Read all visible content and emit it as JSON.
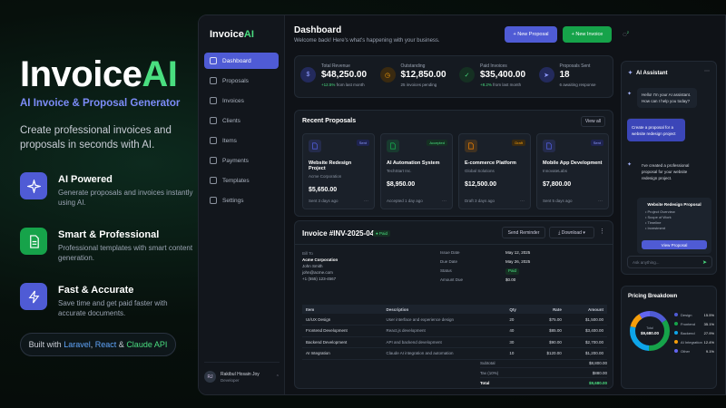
{
  "hero": {
    "brand_main": "Invoice",
    "brand_ai": "AI",
    "tagline": "AI Invoice & Proposal Generator",
    "subtitle": "Create professional invoices and proposals in seconds with AI.",
    "features": [
      {
        "title": "AI Powered",
        "desc": "Generate proposals and invoices instantly using AI.",
        "color": "#4f5bd5"
      },
      {
        "title": "Smart & Professional",
        "desc": "Professional templates with smart content generation.",
        "color": "#16a34a"
      },
      {
        "title": "Fast & Accurate",
        "desc": "Save time and get paid faster with accurate documents.",
        "color": "#4f5bd5"
      }
    ],
    "built_prefix": "Built with ",
    "built_l": "Laravel",
    "built_sep1": ", ",
    "built_r": "React",
    "built_sep2": " & ",
    "built_c": "Claude API"
  },
  "sidebar": {
    "logo_main": "Invoice",
    "logo_ai": "AI",
    "items": [
      {
        "label": "Dashboard"
      },
      {
        "label": "Proposals"
      },
      {
        "label": "Invoices"
      },
      {
        "label": "Clients"
      },
      {
        "label": "Items"
      },
      {
        "label": "Payments"
      },
      {
        "label": "Templates"
      },
      {
        "label": "Settings"
      }
    ],
    "user_initials": "RJ",
    "user_name": "Rakibul Hosain Joy",
    "user_role": "Developer"
  },
  "header": {
    "title": "Dashboard",
    "welcome": "Welcome back! Here's what's happening with your business.",
    "new_proposal": "+ New Proposal",
    "new_invoice": "+ New Invoice",
    "notif_count": "2"
  },
  "stats": [
    {
      "label": "Total Revenue",
      "value": "$48,250.00",
      "change": "+12.5%",
      "note": " from last month",
      "color": "#4f5bd5",
      "icon": "$"
    },
    {
      "label": "Outstanding",
      "value": "$12,850.00",
      "change": "",
      "note": "25 invoices pending",
      "color": "#d97706",
      "icon": "◷"
    },
    {
      "label": "Paid Invoices",
      "value": "$35,400.00",
      "change": "+8.2%",
      "note": " from last month",
      "color": "#16a34a",
      "icon": "✓"
    },
    {
      "label": "Proposals Sent",
      "value": "18",
      "change": "",
      "note": "6 awaiting response",
      "color": "#4f5bd5",
      "icon": "➤"
    }
  ],
  "proposals": {
    "title": "Recent Proposals",
    "view_all": "View all",
    "items": [
      {
        "title": "Website Redesign Project",
        "client": "Acme Corporation",
        "amount": "$5,650.00",
        "date": "Sent 3 days ago",
        "status": "Sent",
        "color": "#4f5bd5",
        "badge_bg": "#1e2350",
        "badge_fg": "#8f9bff"
      },
      {
        "title": "AI Automation System",
        "client": "TechStart Inc.",
        "amount": "$8,950.00",
        "date": "Accepted 1 day ago",
        "status": "Accepted",
        "color": "#16a34a",
        "badge_bg": "#153022",
        "badge_fg": "#4ade80"
      },
      {
        "title": "E-commerce Platform",
        "client": "Global Solutions",
        "amount": "$12,500.00",
        "date": "Draft 3 days ago",
        "status": "Draft",
        "color": "#d97706",
        "badge_bg": "#3a2a10",
        "badge_fg": "#f59e0b"
      },
      {
        "title": "Mobile App Development",
        "client": "InnovateLabs",
        "amount": "$7,800.00",
        "date": "Sent 5 days ago",
        "status": "Sent",
        "color": "#4f5bd5",
        "badge_bg": "#1e2350",
        "badge_fg": "#8f9bff"
      }
    ]
  },
  "invoice": {
    "number": "Invoice #INV-2025-042",
    "status": "Paid",
    "reminder": "Send Reminder",
    "download": "Download",
    "bill_to_label": "Bill To",
    "company": "Acme Corporation",
    "contact": "John Smith",
    "email": "john@acme.com",
    "phone": "+1 (555) 123-4567",
    "meta": [
      {
        "k": "Issue Date",
        "v": "May 12, 2025"
      },
      {
        "k": "Due Date",
        "v": "May 26, 2025"
      },
      {
        "k": "Status",
        "v": "Paid"
      },
      {
        "k": "Amount Due",
        "v": "$0.00"
      }
    ],
    "columns": [
      "Item",
      "Description",
      "Qty",
      "Rate",
      "Amount"
    ],
    "rows": [
      [
        "UI/UX Design",
        "User interface and experience design",
        "20",
        "$75.00",
        "$1,500.00"
      ],
      [
        "Frontend Development",
        "React.js development",
        "40",
        "$85.00",
        "$3,400.00"
      ],
      [
        "Backend Development",
        "API and backend development",
        "30",
        "$90.00",
        "$2,700.00"
      ],
      [
        "AI Integration",
        "Claude AI integration and automation",
        "10",
        "$120.00",
        "$1,200.00"
      ]
    ],
    "subtotal_label": "Subtotal",
    "subtotal": "$8,800.00",
    "tax_label": "Tax (10%)",
    "tax": "$880.00",
    "total_label": "Total",
    "total": "$9,680.00"
  },
  "assistant": {
    "title": "AI Assistant",
    "m1": "Hello! I'm your AI assistant. How can I help you today?",
    "m2": "Create a proposal for a website redesign project",
    "m3": "I've created a professional proposal for your website redesign project.",
    "card_title": "Website Redesign Proposal",
    "card_items": [
      "Project Overview",
      "Scope of Work",
      "Timeline",
      "Investment"
    ],
    "view_btn": "View Proposal",
    "placeholder": "Ask anything..."
  },
  "pricing": {
    "title": "Pricing Breakdown",
    "total_label": "Total",
    "total": "$9,680.00",
    "items": [
      {
        "name": "Design",
        "pct": "15.5%",
        "value": 15.5,
        "color": "#4f5bd5"
      },
      {
        "name": "Frontend",
        "pct": "35.1%",
        "value": 35.1,
        "color": "#16a34a"
      },
      {
        "name": "Backend",
        "pct": "27.9%",
        "value": 27.9,
        "color": "#0ea5e9"
      },
      {
        "name": "AI Integration",
        "pct": "12.4%",
        "value": 12.4,
        "color": "#f59e0b"
      },
      {
        "name": "Other",
        "pct": "9.1%",
        "value": 9.1,
        "color": "#6366f1"
      }
    ]
  }
}
